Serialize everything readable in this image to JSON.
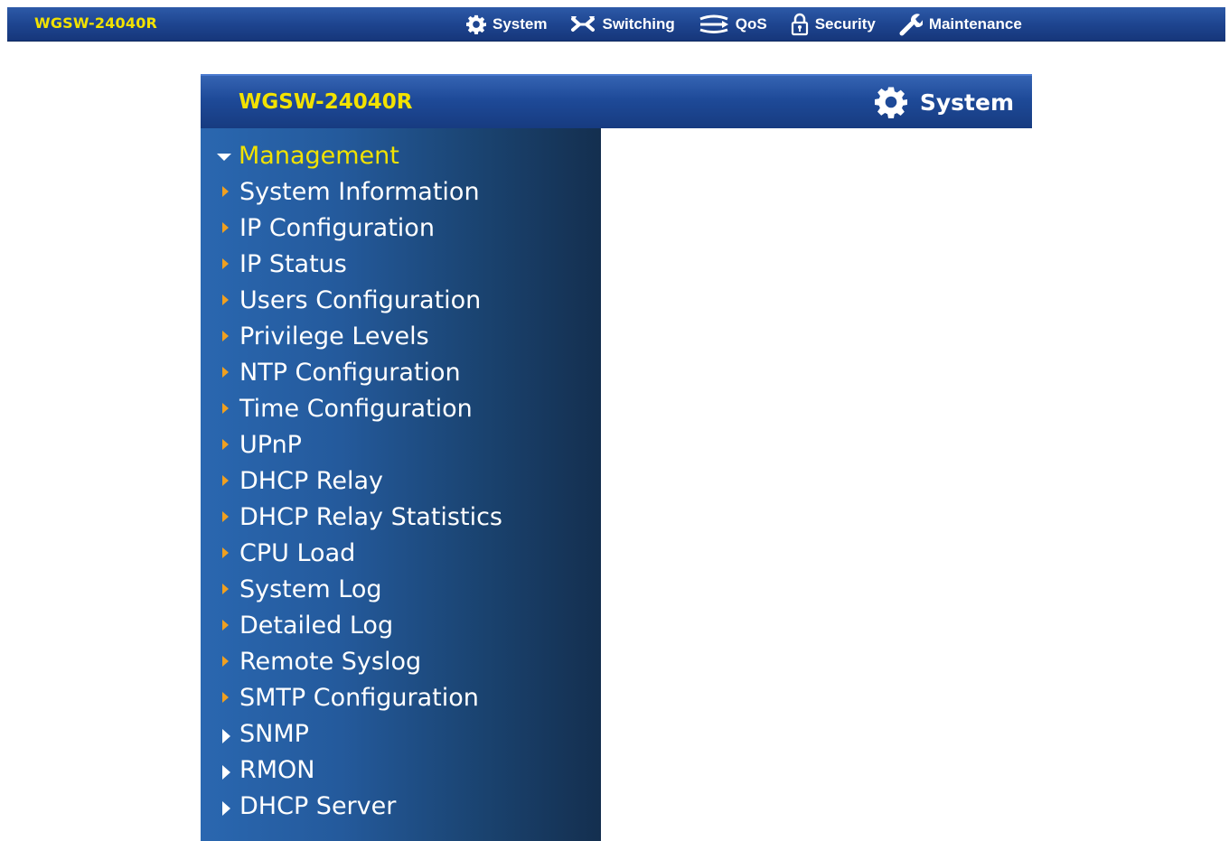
{
  "topbar": {
    "brand": "WGSW-24040R",
    "nav": [
      {
        "label": "System",
        "icon": "gear-icon"
      },
      {
        "label": "Switching",
        "icon": "switching-icon"
      },
      {
        "label": "QoS",
        "icon": "qos-icon"
      },
      {
        "label": "Security",
        "icon": "lock-icon"
      },
      {
        "label": "Maintenance",
        "icon": "wrench-icon"
      }
    ]
  },
  "panel": {
    "brand": "WGSW-24040R",
    "section": "System",
    "section_icon": "gear-icon"
  },
  "sidebar": {
    "open_group": "Management",
    "items": [
      "System Information",
      "IP Configuration",
      "IP Status",
      "Users Configuration",
      "Privilege Levels",
      "NTP Configuration",
      "Time Configuration",
      "UPnP",
      "DHCP Relay",
      "DHCP Relay Statistics",
      "CPU Load",
      "System Log",
      "Detailed Log",
      "Remote Syslog",
      "SMTP Configuration"
    ],
    "groups": [
      "SNMP",
      "RMON",
      "DHCP Server"
    ]
  },
  "colors": {
    "brand_yellow": "#f2e200",
    "bar_blue": "#1e4590",
    "arrow_orange": "#f0a020"
  }
}
